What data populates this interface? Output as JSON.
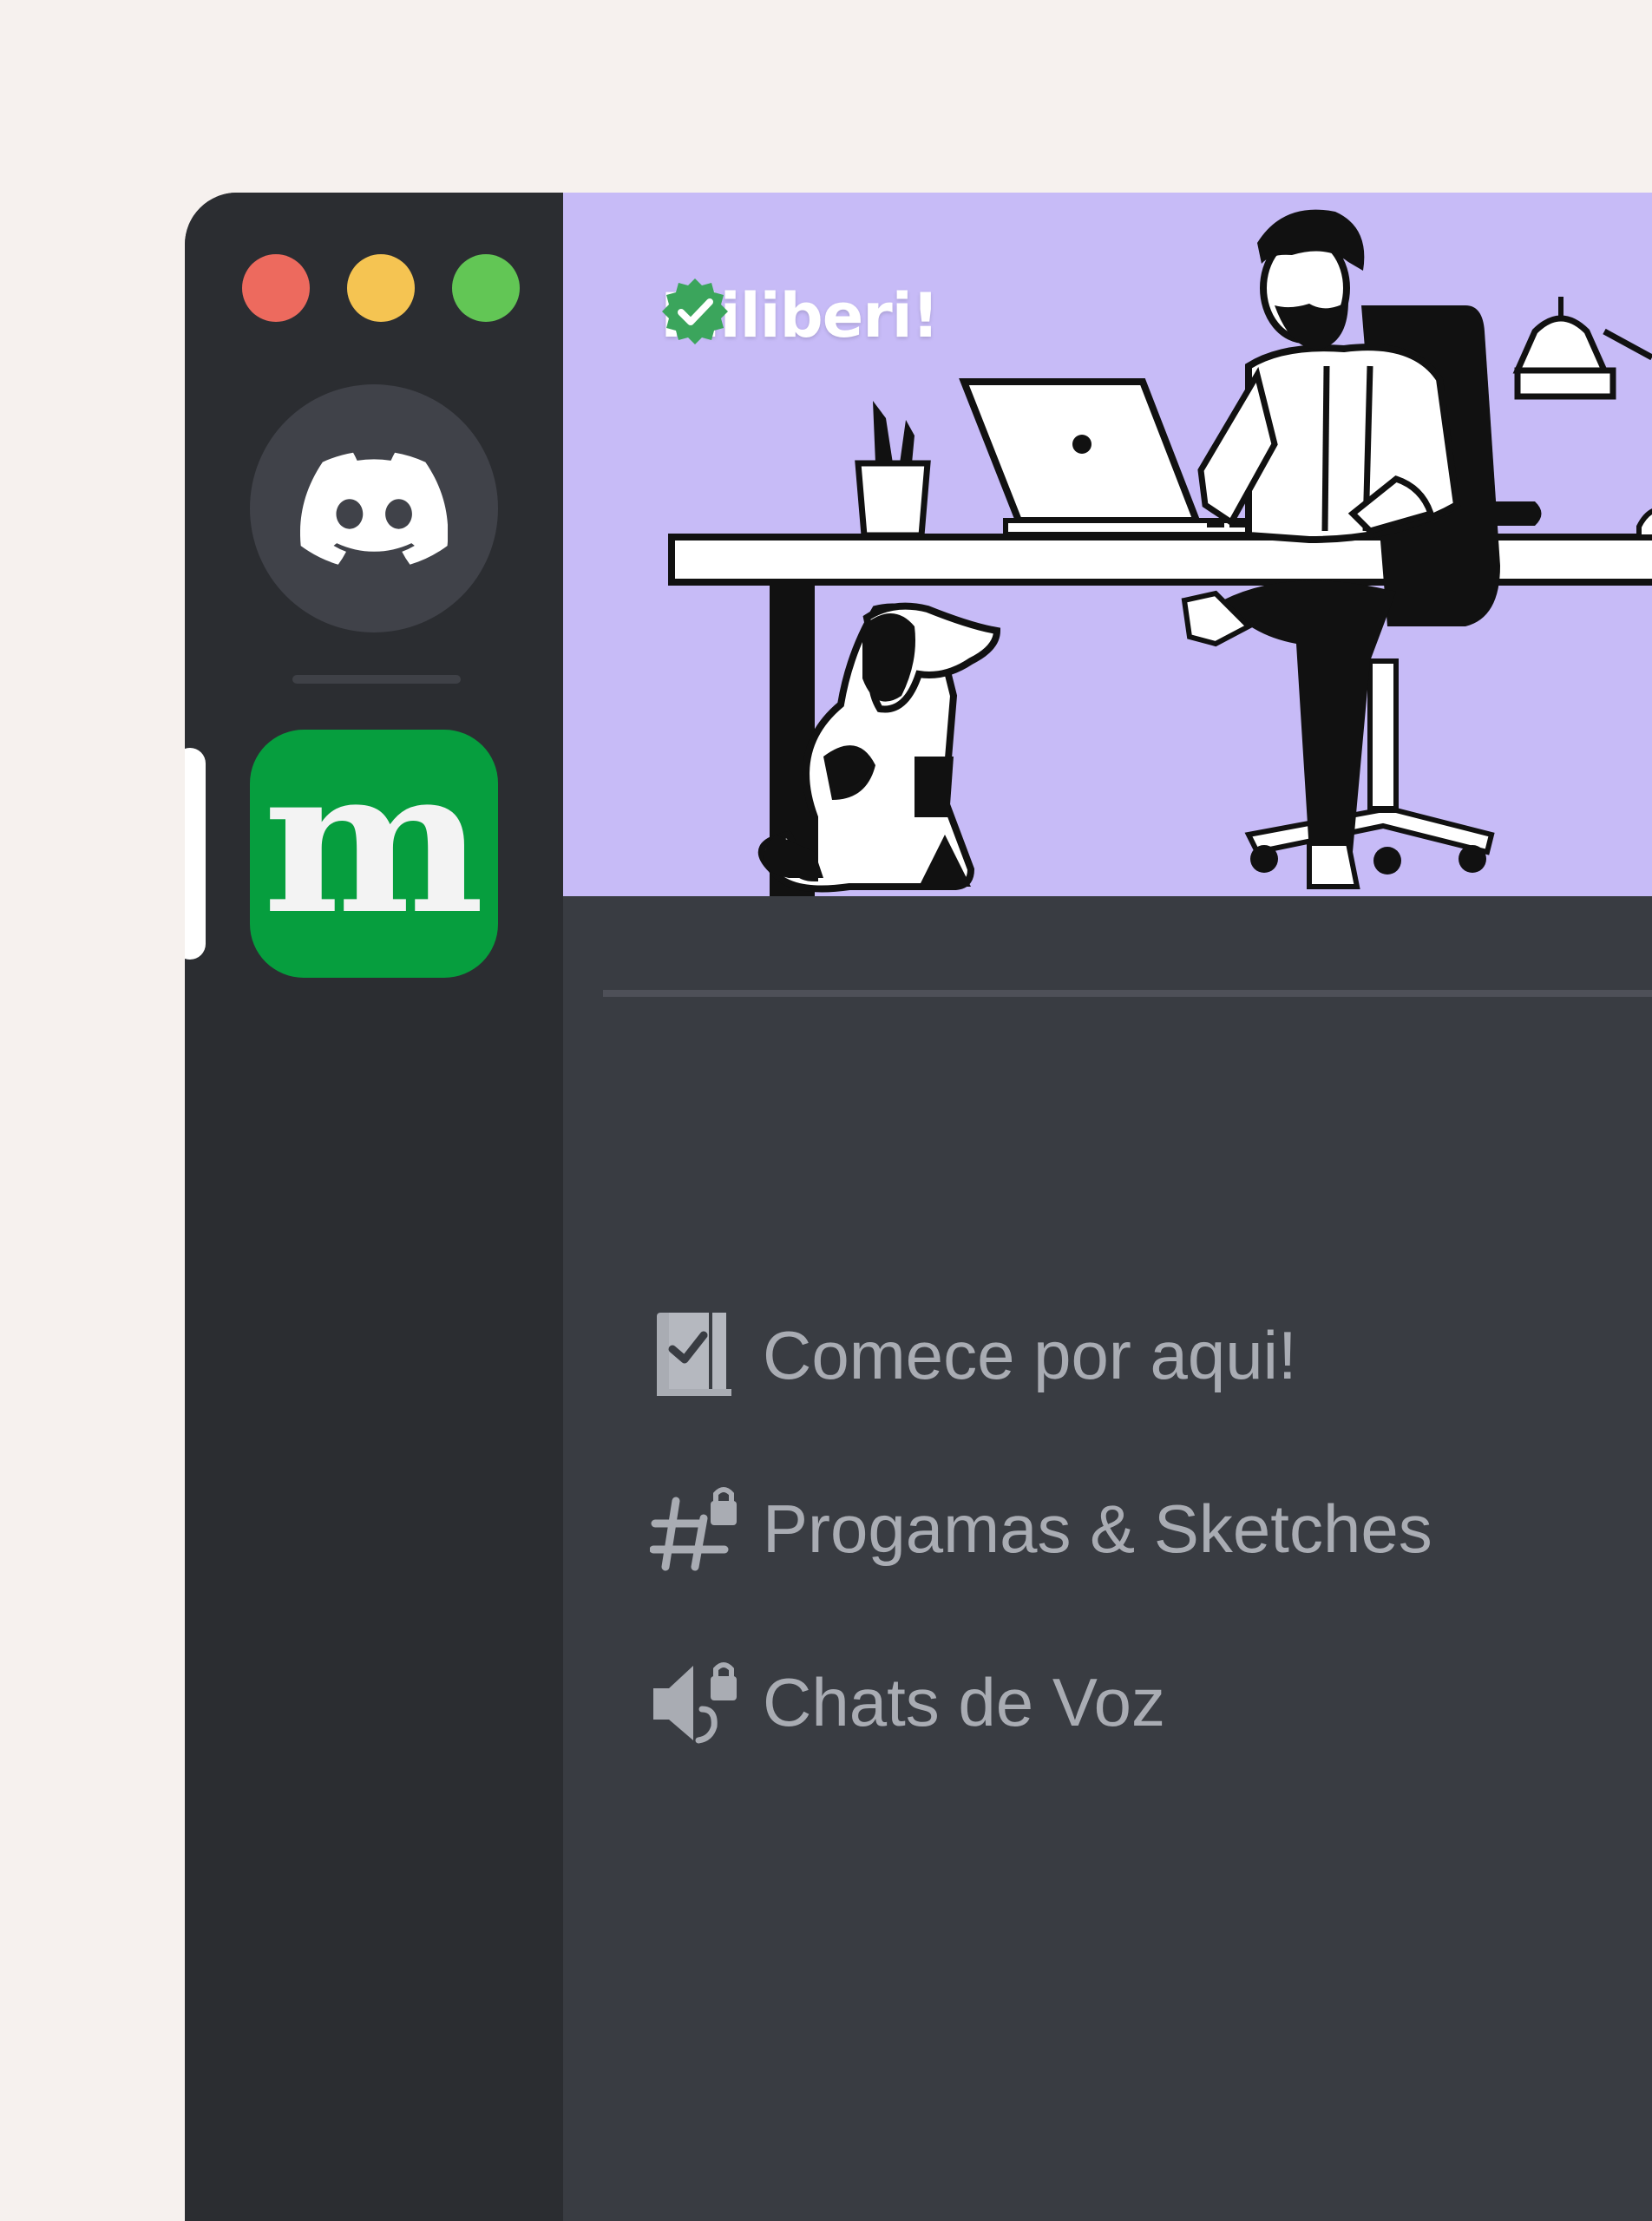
{
  "window": {
    "controls": [
      "close",
      "minimize",
      "maximize"
    ],
    "colors": {
      "close": "#ed6a5e",
      "minimize": "#f5c452",
      "maximize": "#62c655"
    }
  },
  "rail": {
    "home_icon": "discord-icon",
    "server": {
      "letter": "m",
      "color": "#069e3e",
      "selected": true
    }
  },
  "server": {
    "name": "Miliberi!",
    "verified": true,
    "banner_color": "#c7bbf7"
  },
  "channels": [
    {
      "icon": "rules-checklist-icon",
      "label": "Comece por aqui!"
    },
    {
      "icon": "locked-text-channel-icon",
      "label": "Progamas & Sketches"
    },
    {
      "icon": "locked-voice-channel-icon",
      "label": "Chats de Voz"
    }
  ]
}
